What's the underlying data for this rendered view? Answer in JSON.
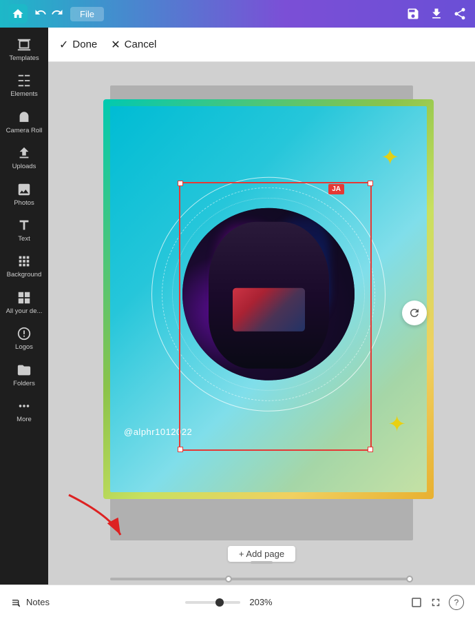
{
  "topbar": {
    "file_label": "File",
    "undo_title": "Undo",
    "redo_title": "Redo"
  },
  "actionbar": {
    "done_label": "Done",
    "cancel_label": "Cancel"
  },
  "sidebar": {
    "items": [
      {
        "id": "templates",
        "label": "Templates"
      },
      {
        "id": "elements",
        "label": "Elements"
      },
      {
        "id": "camera-roll",
        "label": "Camera Roll"
      },
      {
        "id": "uploads",
        "label": "Uploads"
      },
      {
        "id": "photos",
        "label": "Photos"
      },
      {
        "id": "text",
        "label": "Text"
      },
      {
        "id": "background",
        "label": "Background"
      },
      {
        "id": "all-your-de",
        "label": "All your de..."
      },
      {
        "id": "logos",
        "label": "Logos"
      },
      {
        "id": "folders",
        "label": "Folders"
      },
      {
        "id": "more",
        "label": "More"
      }
    ]
  },
  "canvas": {
    "username": "@alphr1012022",
    "ja_badge": "JA",
    "add_page_label": "+ Add page"
  },
  "bottombar": {
    "notes_label": "Notes",
    "zoom_level": "203%",
    "help_label": "?"
  }
}
